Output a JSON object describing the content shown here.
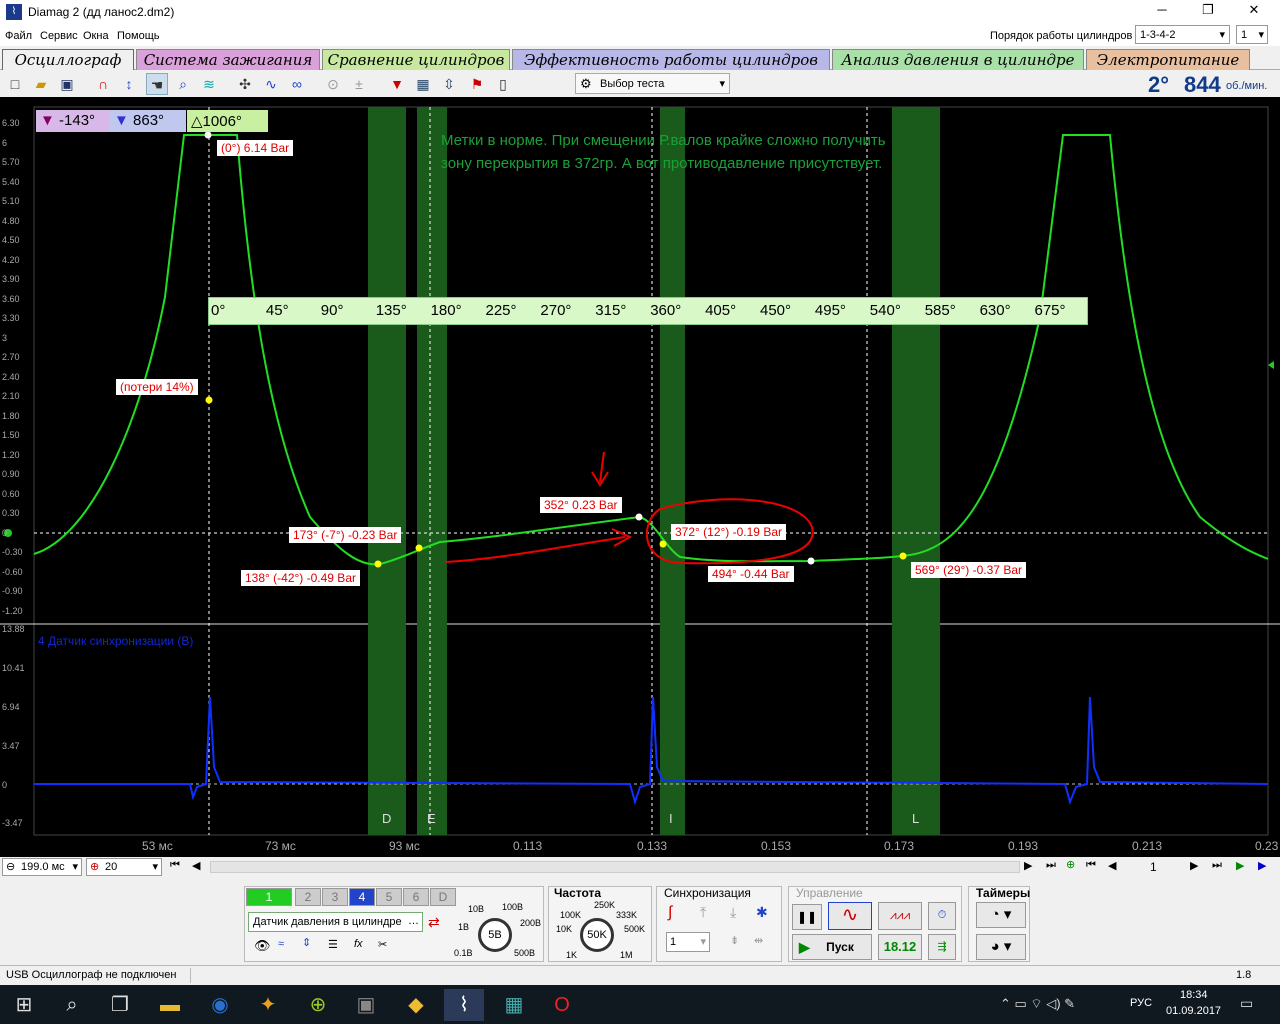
{
  "window": {
    "title": "Diamag 2 (дд ланос2.dm2)",
    "minimize": "─",
    "maximize": "❐",
    "close": "✕"
  },
  "menu": [
    "Файл",
    "Сервис",
    "Окна",
    "Помощь"
  ],
  "cyl_order": {
    "label": "Порядок работы цилиндров",
    "value": "1-3-4-2",
    "count": "1"
  },
  "tabs": [
    {
      "label": "Осциллограф",
      "color": "#f0f0f0"
    },
    {
      "label": "Система зажигания",
      "color": "#d9a0d9"
    },
    {
      "label": "Сравнение цилиндров",
      "color": "#c8e8a0"
    },
    {
      "label": "Эффективность работы цилиндров",
      "color": "#b8b8e8"
    },
    {
      "label": "Анализ давления в цилиндре",
      "color": "#a8e0a8"
    },
    {
      "label": "Электропитание",
      "color": "#e8c0a0"
    }
  ],
  "toolbar": {
    "test_select": "Выбор теста",
    "angle": "2°",
    "rpm": "844",
    "rpm_unit": "об./мин."
  },
  "markers": {
    "m1": "-143°",
    "m2": "863°",
    "delta": "1006°"
  },
  "note": "Метки в норме. При смещении Р.валов крайке сложно получить\nзону перекрытия в 372гр. А вот противодавление присутствует.",
  "upper_y_ticks": [
    "6.30",
    "6",
    "5.70",
    "5.40",
    "5.10",
    "4.80",
    "4.50",
    "4.20",
    "3.90",
    "3.60",
    "3.30",
    "3",
    "2.70",
    "2.40",
    "2.10",
    "1.80",
    "1.50",
    "1.20",
    "0.90",
    "0.60",
    "0.30",
    "0",
    "-0.30",
    "-0.60",
    "-0.90",
    "-1.20"
  ],
  "angle_scale": [
    "0°",
    "45°",
    "90°",
    "135°",
    "180°",
    "225°",
    "270°",
    "315°",
    "360°",
    "405°",
    "450°",
    "495°",
    "540°",
    "585°",
    "630°",
    "675°"
  ],
  "point_labels": {
    "p0": "(0°) 6.14 Bar",
    "loss": "(потери 14%)",
    "p173": "173° (-7°) -0.23 Bar",
    "p138": "138° (-42°) -0.49 Bar",
    "p352": "352° 0.23 Bar",
    "p372": "372° (12°) -0.19 Bar",
    "p494": "494° -0.44 Bar",
    "p569": "569° (29°) -0.37 Bar"
  },
  "lower_channel": {
    "title": "4 Датчик синхронизации (В)",
    "y_ticks": [
      "13.88",
      "10.41",
      "6.94",
      "3.47",
      "0",
      "-3.47"
    ]
  },
  "zone_letters": [
    "D",
    "E",
    "I",
    "L"
  ],
  "x_ticks": [
    "53 мс",
    "73 мс",
    "93 мс",
    "0.113",
    "0.133",
    "0.153",
    "0.173",
    "0.193",
    "0.213",
    "0.23"
  ],
  "timebase": {
    "value": "199.0 мс",
    "zoom": "20",
    "page": "1"
  },
  "control": {
    "channels": [
      "1",
      "2",
      "3",
      "4",
      "5",
      "6",
      "D"
    ],
    "sensor": "Датчик давления в цилиндре",
    "volt_labels": [
      "10В",
      "100В",
      "1В",
      "200В",
      "0.1В",
      "500В"
    ],
    "volt_value": "5В",
    "freq_title": "Частота",
    "freq_labels": [
      "250K",
      "100K",
      "333K",
      "10K",
      "500K",
      "1K",
      "1M"
    ],
    "freq_value": "50K",
    "sync_title": "Синхронизация",
    "sync_value": "1",
    "ctrl_title": "Управление",
    "start": "Пуск",
    "ver": "18.12",
    "timers_title": "Таймеры"
  },
  "status": {
    "text": "USB Осциллограф не подключен",
    "right": "1.8"
  },
  "taskbar": {
    "lang": "РУС",
    "time": "18:34",
    "date": "01.09.2017"
  },
  "colors": {
    "trace_pressure": "#22dd22",
    "trace_sync": "#1030ff",
    "zone": "#1a5a1a",
    "annot": "#e00000"
  }
}
